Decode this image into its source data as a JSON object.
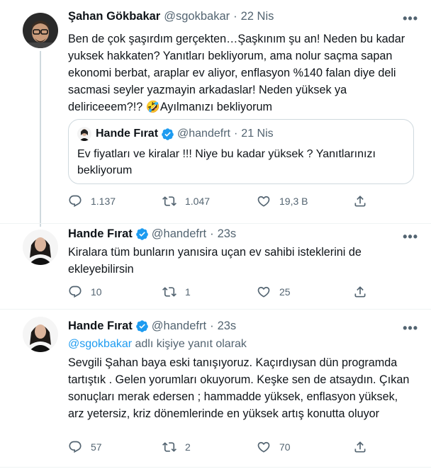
{
  "tweet1": {
    "name": "Şahan Gökbakar",
    "handle": "@sgokbakar",
    "dot": "·",
    "time": "22 Nis",
    "more": "•••",
    "text": "Ben de çok şaşırdım gerçekten…Şaşkınım şu an! Neden bu kadar yuksek hakkaten? Yanıtları bekliyorum, ama nolur saçma sapan ekonomi berbat, araplar ev aliyor, enflasyon %140 falan diye deli sacmasi seyler yazmayin arkadaslar! Neden yüksek ya deliriceeem?!? 🤣Ayılmanızı bekliyorum",
    "quote": {
      "name": "Hande Fırat",
      "handle": "@handefrt",
      "dot": "·",
      "time": "21 Nis",
      "text": "Ev fiyatları ve kiralar !!! Niye bu kadar yüksek ? Yanıtlarınızı bekliyorum"
    },
    "replies": "1.137",
    "retweets": "1.047",
    "likes": "19,3 B"
  },
  "tweet2": {
    "name": "Hande Fırat",
    "handle": "@handefrt",
    "dot": "·",
    "time": "23s",
    "more": "•••",
    "text": "Kiralara tüm bunların yanısira uçan ev sahibi isteklerini de ekleyebilirsin",
    "replies": "10",
    "retweets": "1",
    "likes": "25"
  },
  "tweet3": {
    "name": "Hande Fırat",
    "handle": "@handefrt",
    "dot": "·",
    "time": "23s",
    "more": "•••",
    "reply_to_handle": "@sgokbakar",
    "reply_to_suffix": " adlı kişiye yanıt olarak",
    "text": "Sevgili Şahan baya eski tanışıyoruz. Kaçırdıysan dün programda tartıştık . Gelen yorumları okuyorum. Keşke sen de atsaydın. Çıkan sonuçları merak edersen ; hammadde yüksek, enflasyon yüksek, arz yetersiz, kriz dönemlerinde en yüksek artış konutta oluyor",
    "replies": "57",
    "retweets": "2",
    "likes": "70"
  },
  "colors": {
    "accent": "#1d9bf0",
    "secondary_text": "#536471",
    "border": "#cfd9de"
  }
}
